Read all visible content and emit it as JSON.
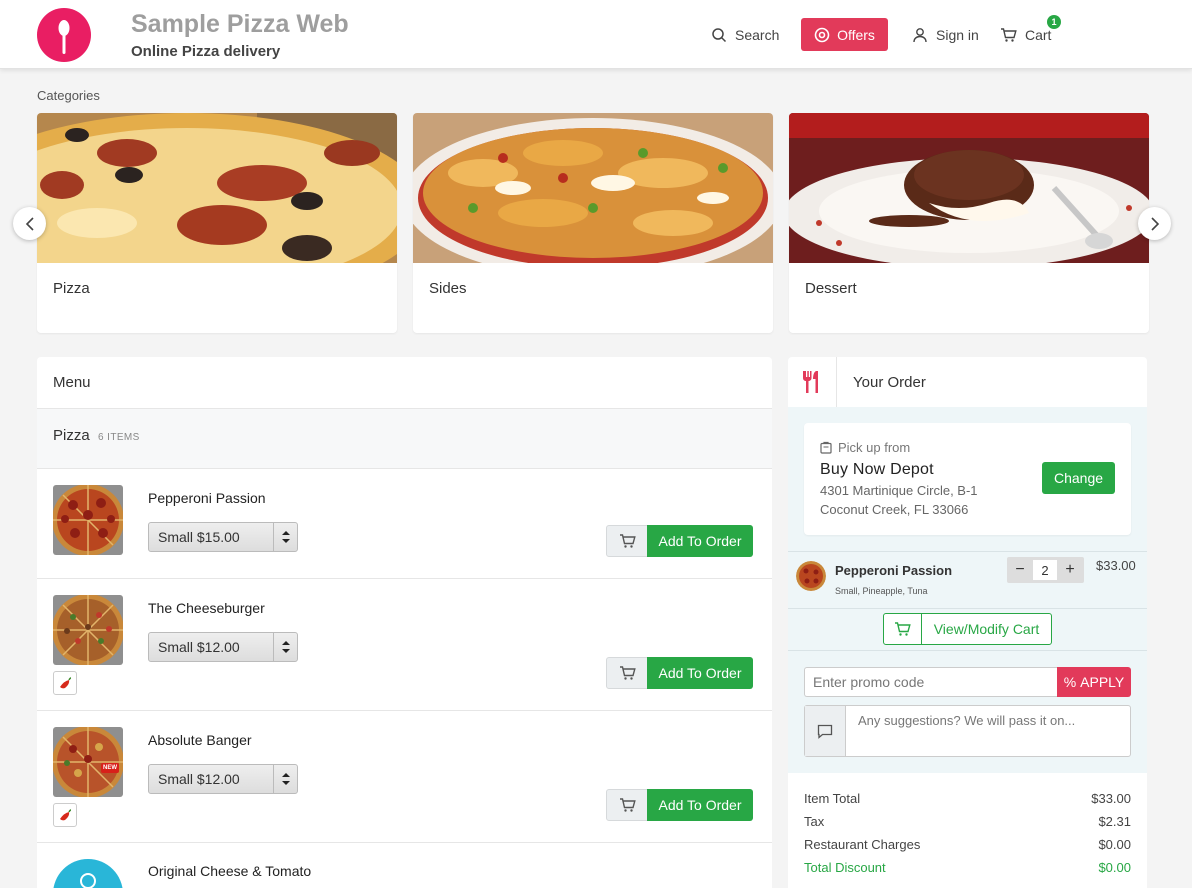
{
  "header": {
    "brand_title": "Sample Pizza Web",
    "brand_subtitle": "Online Pizza delivery",
    "nav": {
      "search": "Search",
      "offers": "Offers",
      "signin": "Sign in",
      "cart": "Cart",
      "cart_count": "1"
    }
  },
  "categories": {
    "label": "Categories",
    "items": [
      {
        "name": "Pizza"
      },
      {
        "name": "Sides"
      },
      {
        "name": "Dessert"
      }
    ]
  },
  "menu": {
    "title": "Menu",
    "section": {
      "name": "Pizza",
      "count": "6 ITEMS"
    },
    "items": [
      {
        "name": "Pepperoni Passion",
        "size": "Small $15.00",
        "add_label": "Add To Order"
      },
      {
        "name": "The Cheeseburger",
        "size": "Small $12.00",
        "add_label": "Add To Order"
      },
      {
        "name": "Absolute Banger",
        "size": "Small $12.00",
        "add_label": "Add To Order",
        "badge": "NEW"
      },
      {
        "name": "Original Cheese & Tomato"
      }
    ]
  },
  "order": {
    "title": "Your Order",
    "pickup_label": "Pick up from",
    "store_name": "Buy Now Depot",
    "store_addr1": "4301 Martinique Circle, B-1",
    "store_addr2": "Coconut Creek, FL 33066",
    "change_label": "Change",
    "line": {
      "name": "Pepperoni Passion",
      "options": "Small, Pineapple, Tuna",
      "qty": "2",
      "price": "$33.00"
    },
    "view_cart_label": "View/Modify Cart",
    "promo_placeholder": "Enter promo code",
    "apply_label": "APPLY",
    "suggest_placeholder": "Any suggestions? We will pass it on...",
    "totals": [
      {
        "label": "Item Total",
        "value": "$33.00"
      },
      {
        "label": "Tax",
        "value": "$2.31"
      },
      {
        "label": "Restaurant Charges",
        "value": "$0.00"
      },
      {
        "label": "Total Discount",
        "value": "$0.00"
      }
    ]
  },
  "colors": {
    "brand": "#e91e63",
    "offers": "#e23a5a",
    "primary_green": "#28a745"
  }
}
